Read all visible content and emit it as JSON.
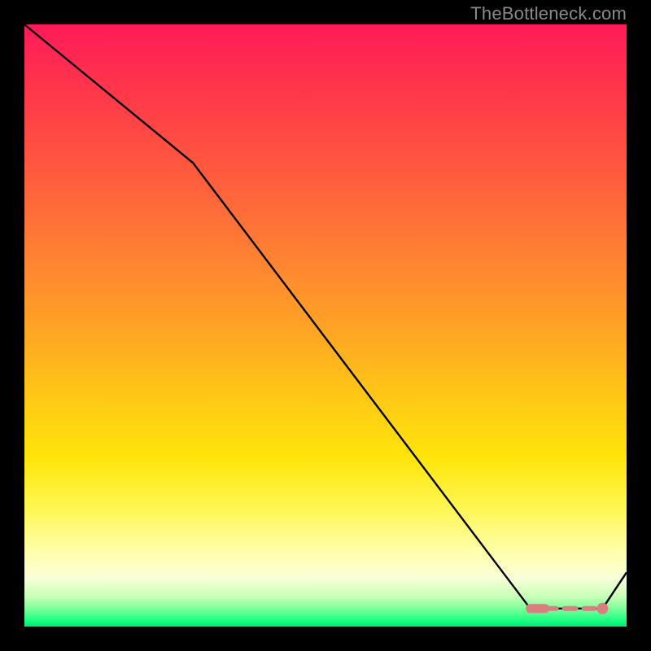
{
  "watermark": "TheBottleneck.com",
  "chart_data": {
    "type": "line",
    "title": "",
    "xlabel": "",
    "ylabel": "",
    "xlim": [
      0,
      100
    ],
    "ylim": [
      0,
      100
    ],
    "series": [
      {
        "name": "bottleneck-curve",
        "x": [
          0,
          28,
          84,
          96,
          100
        ],
        "y": [
          100,
          77,
          3,
          3,
          9
        ],
        "color": "#000000"
      }
    ],
    "highlight": {
      "name": "optimal-range",
      "color": "#d97f7f",
      "x_range": [
        84,
        96
      ],
      "marker_x": 96
    },
    "gradient_stops": [
      {
        "pos": 0,
        "color": "#ff1a58"
      },
      {
        "pos": 50,
        "color": "#ffa225"
      },
      {
        "pos": 80,
        "color": "#fff650"
      },
      {
        "pos": 100,
        "color": "#00e874"
      }
    ]
  }
}
